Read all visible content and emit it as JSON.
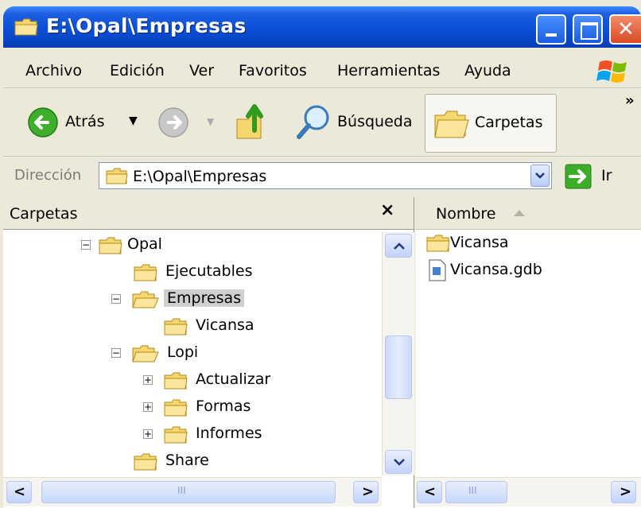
{
  "window": {
    "title": "E:\\Opal\\Empresas"
  },
  "menu": [
    "Archivo",
    "Edición",
    "Ver",
    "Favoritos",
    "Herramientas",
    "Ayuda"
  ],
  "toolbar": {
    "back_label": "Atrás",
    "search_label": "Búsqueda",
    "folders_label": "Carpetas",
    "more_label": "»"
  },
  "address": {
    "label": "Dirección",
    "value": "E:\\Opal\\Empresas",
    "go_label": "Ir"
  },
  "folders_pane": {
    "title": "Carpetas",
    "close": "×",
    "tree": [
      {
        "label": "Opal",
        "expander": "−"
      },
      {
        "label": "Ejecutables"
      },
      {
        "label": "Empresas",
        "expander": "−",
        "selected": true
      },
      {
        "label": "Vicansa"
      },
      {
        "label": "Lopi",
        "expander": "−"
      },
      {
        "label": "Actualizar",
        "expander": "+"
      },
      {
        "label": "Formas",
        "expander": "+"
      },
      {
        "label": "Informes",
        "expander": "+"
      },
      {
        "label": "Share"
      }
    ]
  },
  "file_pane": {
    "column": "Nombre",
    "items": [
      {
        "name": "Vicansa",
        "type": "folder"
      },
      {
        "name": "Vicansa.gdb",
        "type": "file"
      }
    ]
  },
  "scroll": {
    "left_arrow": "<",
    "right_arrow": ">",
    "grip": "III"
  }
}
